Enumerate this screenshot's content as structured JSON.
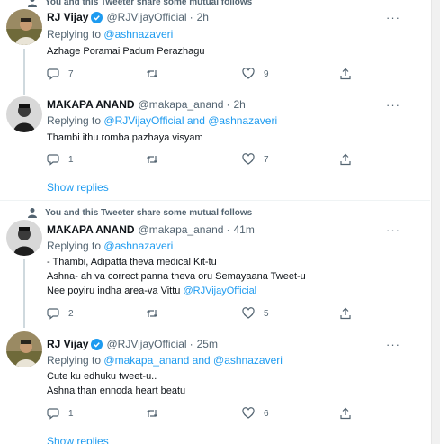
{
  "context_line": "You and this Tweeter share some mutual follows",
  "show_replies_label": "Show replies",
  "tweets": [
    {
      "name": "RJ Vijay",
      "verified": true,
      "handle": "@RJVijayOfficial",
      "dot": "·",
      "time": "2h",
      "replying_prefix": "Replying to",
      "replying_mentions": "@ashnazaveri",
      "replying_and": "",
      "replying_mentions_2": "",
      "lines": [
        "Azhage Poramai Padum Perazhagu"
      ],
      "stats": {
        "replies": "7",
        "retweets": "",
        "likes": "9"
      }
    },
    {
      "name": "MAKAPA ANAND",
      "verified": false,
      "handle": "@makapa_anand",
      "dot": "·",
      "time": "2h",
      "replying_prefix": "Replying to",
      "replying_mentions": "@RJVijayOfficial",
      "replying_and": "and",
      "replying_mentions_2": "@ashnazaveri",
      "lines": [
        "Thambi ithu romba pazhaya visyam"
      ],
      "stats": {
        "replies": "1",
        "retweets": "",
        "likes": "7"
      }
    },
    {
      "name": "MAKAPA ANAND",
      "verified": false,
      "handle": "@makapa_anand",
      "dot": "·",
      "time": "41m",
      "replying_prefix": "Replying to",
      "replying_mentions": "@ashnazaveri",
      "replying_and": "",
      "replying_mentions_2": "",
      "lines": [
        "- Thambi, Adipatta theva medical  Kit-tu",
        "Ashna- ah va correct panna theva oru Semayaana Tweet-u",
        "Nee poyiru indha area-va Vittu "
      ],
      "line3_mention": "@RJVijayOfficial",
      "stats": {
        "replies": "2",
        "retweets": "",
        "likes": "5"
      }
    },
    {
      "name": "RJ Vijay",
      "verified": true,
      "handle": "@RJVijayOfficial",
      "dot": "·",
      "time": "25m",
      "replying_prefix": "Replying to",
      "replying_mentions": "@makapa_anand",
      "replying_and": "and",
      "replying_mentions_2": "@ashnazaveri",
      "lines": [
        "Cute ku edhuku  tweet-u..",
        "Ashna than ennoda heart beatu"
      ],
      "stats": {
        "replies": "1",
        "retweets": "",
        "likes": "6"
      }
    }
  ],
  "icons": {
    "more": "more-icon",
    "reply": "reply-icon",
    "retweet": "retweet-icon",
    "like": "like-icon",
    "share": "share-icon",
    "verified": "verified-badge-icon",
    "context": "person-icon"
  },
  "colors": {
    "accent": "#1d9bf0",
    "secondary_text": "#536471",
    "thread_line": "#cfd9de"
  }
}
